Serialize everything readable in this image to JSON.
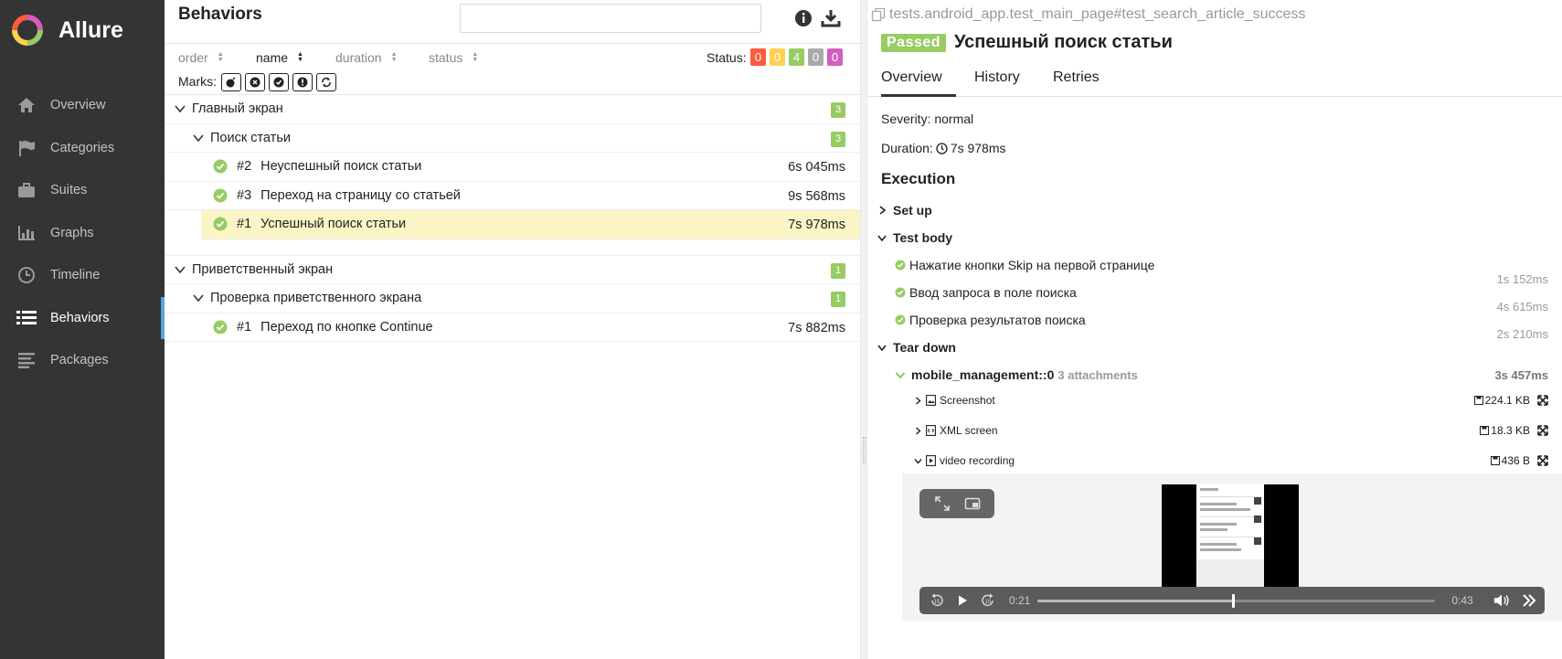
{
  "app": {
    "name": "Allure"
  },
  "sidebar": {
    "items": [
      {
        "label": "Overview",
        "icon": "home-icon"
      },
      {
        "label": "Categories",
        "icon": "flag-icon"
      },
      {
        "label": "Suites",
        "icon": "briefcase-icon"
      },
      {
        "label": "Graphs",
        "icon": "bar-chart-icon"
      },
      {
        "label": "Timeline",
        "icon": "clock-icon"
      },
      {
        "label": "Behaviors",
        "icon": "list-icon",
        "active": true
      },
      {
        "label": "Packages",
        "icon": "align-left-icon"
      }
    ]
  },
  "behaviors": {
    "title": "Behaviors",
    "search_value": "",
    "sort": [
      {
        "label": "order"
      },
      {
        "label": "name",
        "active": true
      },
      {
        "label": "duration"
      },
      {
        "label": "status"
      }
    ],
    "status_label": "Status:",
    "status_counts": [
      {
        "value": "0",
        "color": "#fd5a3e"
      },
      {
        "value": "0",
        "color": "#ffd050"
      },
      {
        "value": "4",
        "color": "#97cc64"
      },
      {
        "value": "0",
        "color": "#aaaaaa"
      },
      {
        "value": "0",
        "color": "#d35ebe"
      }
    ],
    "marks_label": "Marks:",
    "groups": [
      {
        "name": "Главный экран",
        "count": "3",
        "features": [
          {
            "name": "Поиск статьи",
            "count": "3",
            "tests": [
              {
                "order": "#2",
                "name": "Неуспешный поиск статьи",
                "duration": "6s 045ms"
              },
              {
                "order": "#3",
                "name": "Переход на страницу со статьей",
                "duration": "9s 568ms"
              },
              {
                "order": "#1",
                "name": "Успешный поиск статьи",
                "duration": "7s 978ms",
                "selected": true
              }
            ]
          }
        ]
      },
      {
        "name": "Приветственный экран",
        "count": "1",
        "features": [
          {
            "name": "Проверка приветственного экрана",
            "count": "1",
            "tests": [
              {
                "order": "#1",
                "name": "Переход по кнопке Continue",
                "duration": "7s 882ms"
              }
            ]
          }
        ]
      }
    ]
  },
  "test": {
    "path": "tests.android_app.test_main_page#test_search_article_success",
    "status": "Passed",
    "title": "Успешный поиск статьи",
    "tabs": [
      "Overview",
      "History",
      "Retries"
    ],
    "severity": "Severity: normal",
    "duration_label": "Duration:",
    "duration_value": "7s 978ms",
    "execution_title": "Execution",
    "setup_label": "Set up",
    "body_label": "Test body",
    "steps": [
      {
        "name": "Нажатие кнопки Skip на первой странице",
        "duration": "1s 152ms"
      },
      {
        "name": "Ввод запроса в поле поиска",
        "duration": "4s 615ms"
      },
      {
        "name": "Проверка результатов поиска",
        "duration": "2s 210ms"
      }
    ],
    "teardown_label": "Tear down",
    "fixture": {
      "name": "mobile_management::0",
      "attachments_label": "3 attachments",
      "duration": "3s 457ms"
    },
    "attachments": [
      {
        "name": "Screenshot",
        "size": "224.1 KB"
      },
      {
        "name": "XML screen",
        "size": "18.3 KB"
      },
      {
        "name": "video recording",
        "size": "436 B"
      }
    ],
    "video": {
      "current_time": "0:21",
      "total_time": "0:43",
      "progress": 0.49
    }
  },
  "colors": {
    "passed": "#97cc64",
    "sidebar_bg": "#343434",
    "accent": "#5aa4d8"
  }
}
